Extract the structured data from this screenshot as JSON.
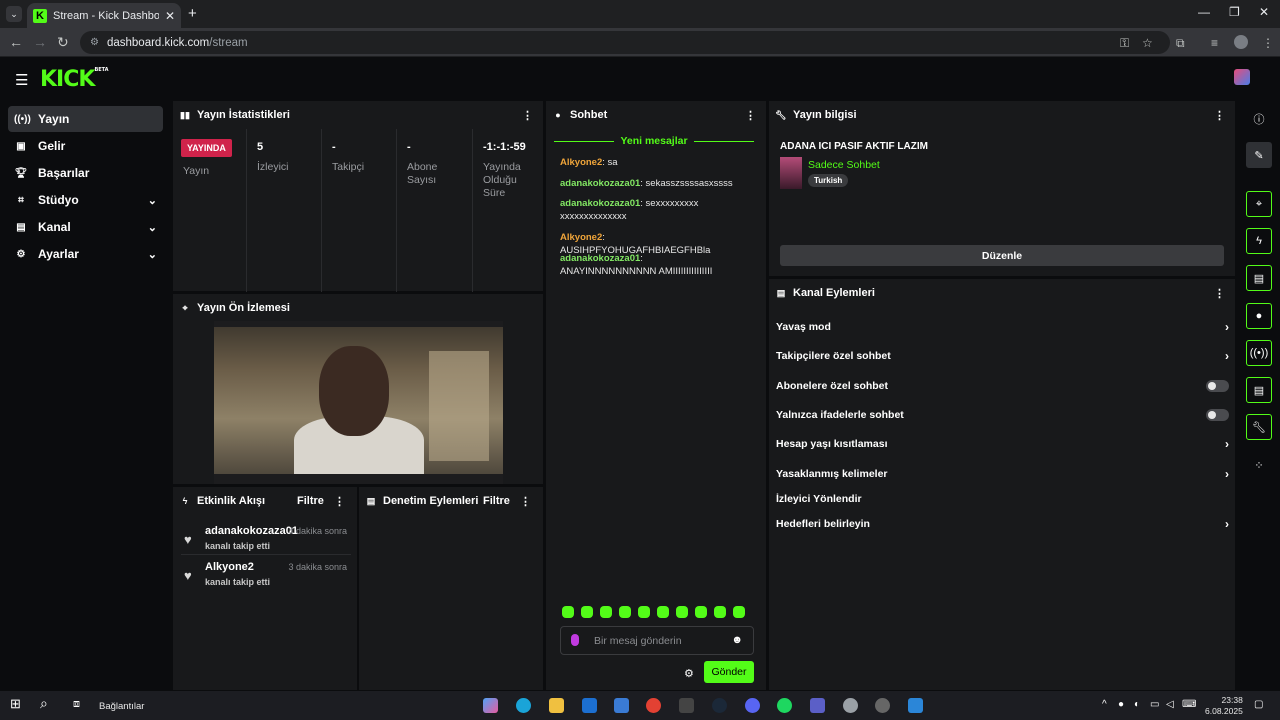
{
  "browser": {
    "tab_title": "Stream - Kick Dashboard",
    "url_host": "dashboard.kick.com",
    "url_path": "/stream"
  },
  "header": {
    "logo": "KICK",
    "logo_badge": "BETA"
  },
  "sidebar": {
    "items": [
      {
        "label": "Yayın",
        "icon": "broadcast-icon"
      },
      {
        "label": "Gelir",
        "icon": "revenue-icon"
      },
      {
        "label": "Başarılar",
        "icon": "trophy-icon"
      },
      {
        "label": "Stüdyo",
        "icon": "studio-icon"
      },
      {
        "label": "Kanal",
        "icon": "channel-icon"
      },
      {
        "label": "Ayarlar",
        "icon": "gear-icon"
      }
    ]
  },
  "stats": {
    "title": "Yayın İstatistikleri",
    "live_badge": "YAYINDA",
    "columns": [
      {
        "value": "",
        "label": "Yayın"
      },
      {
        "value": "5",
        "label": "İzleyici"
      },
      {
        "value": "-",
        "label": "Takipçi"
      },
      {
        "value": "-",
        "label": "Abone Sayısı"
      },
      {
        "value": "-1:-1:-59",
        "label": "Yayında Olduğu Süre"
      }
    ]
  },
  "preview": {
    "title": "Yayın Ön İzlemesi"
  },
  "events": {
    "title": "Etkinlik Akışı",
    "filter": "Filtre",
    "items": [
      {
        "name": "adanakokozaza01",
        "time": "4 dakika sonra",
        "action": "kanalı takip etti"
      },
      {
        "name": "Alkyone2",
        "time": "3 dakika sonra",
        "action": "kanalı takip etti"
      }
    ]
  },
  "moderation": {
    "title": "Denetim Eylemleri",
    "filter": "Filtre"
  },
  "chat": {
    "title": "Sohbet",
    "new_messages": "Yeni mesajlar",
    "messages": [
      {
        "user": "Alkyone2",
        "color": "#f0a53a",
        "text": ": sa"
      },
      {
        "user": "adanakokozaza01",
        "color": "#83e864",
        "text": ": sekasszssssasxssss"
      },
      {
        "user": "adanakokozaza01",
        "color": "#83e864",
        "text": ": sexxxxxxxxxxxxxxxxxxxxxxx"
      },
      {
        "user": "Alkyone2",
        "color": "#f0a53a",
        "text": ": AUSIHPFYOHUGAFHBIAEGFHBla"
      },
      {
        "user": "adanakokozaza01",
        "color": "#83e864",
        "text": ": ANAYINNNNNNNNNN AMIIIIIIIIIIIIIII"
      }
    ],
    "placeholder": "Bir mesaj gönderin",
    "send": "Gönder"
  },
  "stream_info": {
    "title": "Yayın bilgisi",
    "stream_title": "ADANA ICI PASIF AKTIF LAZIM",
    "category": "Sadece Sohbet",
    "language": "Turkish",
    "edit": "Düzenle"
  },
  "channel_actions": {
    "title": "Kanal Eylemleri",
    "items": [
      {
        "label": "Yavaş mod",
        "control": "arrow"
      },
      {
        "label": "Takipçilere özel sohbet",
        "control": "arrow"
      },
      {
        "label": "Abonelere özel sohbet",
        "control": "toggle"
      },
      {
        "label": "Yalnızca ifadelerle sohbet",
        "control": "toggle"
      },
      {
        "label": "Hesap yaşı kısıtlaması",
        "control": "arrow"
      },
      {
        "label": "Yasaklanmış kelimeler",
        "control": "arrow"
      },
      {
        "label": "İzleyici Yönlendir",
        "control": "none"
      },
      {
        "label": "Hedefleri belirleyin",
        "control": "arrow"
      }
    ]
  },
  "taskbar": {
    "label": "Bağlantılar",
    "time": "23:38",
    "date": "6.08.2025"
  },
  "colors": {
    "accent": "#53fc18",
    "live": "#d0234b"
  }
}
